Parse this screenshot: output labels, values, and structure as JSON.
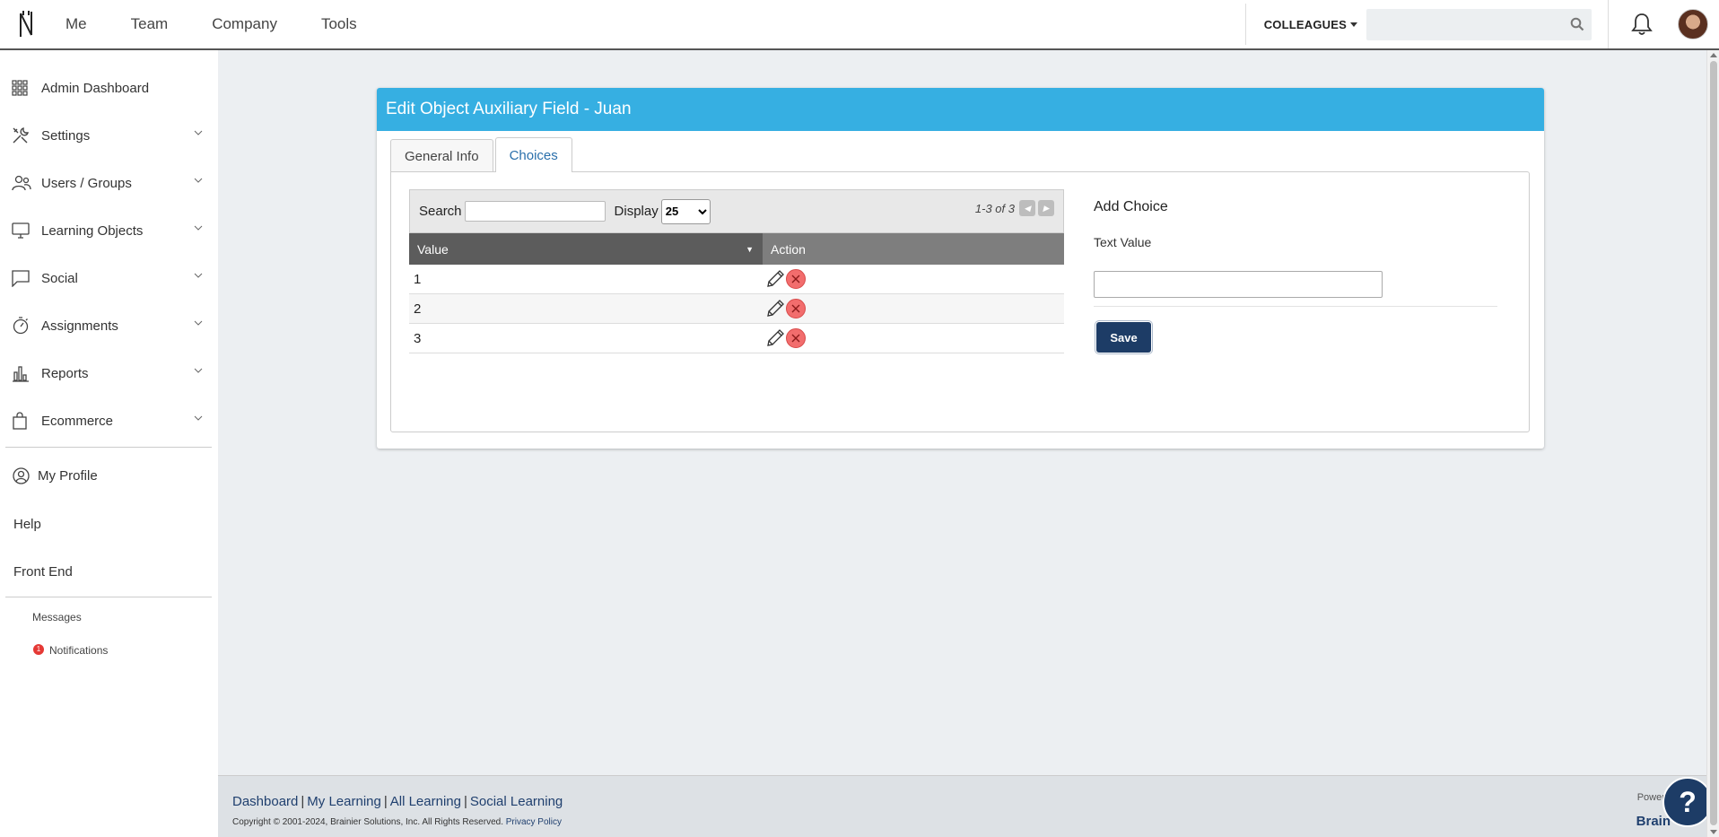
{
  "topnav": {
    "items": [
      "Me",
      "Team",
      "Company",
      "Tools"
    ],
    "colleagues_label": "COLLEAGUES",
    "search_placeholder": ""
  },
  "sidebar": {
    "items": [
      {
        "label": "Admin Dashboard",
        "icon": "grid-icon"
      },
      {
        "label": "Settings",
        "icon": "tools-icon"
      },
      {
        "label": "Users / Groups",
        "icon": "users-icon"
      },
      {
        "label": "Learning Objects",
        "icon": "monitor-icon"
      },
      {
        "label": "Social",
        "icon": "chat-icon"
      },
      {
        "label": "Assignments",
        "icon": "timer-icon"
      },
      {
        "label": "Reports",
        "icon": "bar-chart-icon"
      },
      {
        "label": "Ecommerce",
        "icon": "shopping-bag-icon"
      }
    ],
    "my_profile": "My Profile",
    "help": "Help",
    "front_end": "Front End",
    "messages": "Messages",
    "notifications": "Notifications",
    "notification_count": "1"
  },
  "panel": {
    "title": "Edit Object Auxiliary Field - Juan",
    "tabs": [
      "General Info",
      "Choices"
    ],
    "active_tab": "Choices"
  },
  "grid": {
    "search_label": "Search",
    "display_label": "Display",
    "display_value": "25",
    "pager_text": "1-3 of 3",
    "columns": [
      "Value",
      "Action"
    ],
    "rows": [
      "1",
      "2",
      "3"
    ]
  },
  "add_choice": {
    "title": "Add Choice",
    "text_value_label": "Text Value",
    "text_value": "",
    "save_label": "Save"
  },
  "footer": {
    "links": [
      "Dashboard",
      "My Learning",
      "All Learning",
      "Social Learning"
    ],
    "copyright": "Copyright © 2001-2024, Brainier Solutions, Inc. All Rights Reserved.",
    "privacy": "Privacy Policy",
    "powered": "Powere",
    "brand": "Brain"
  },
  "colors": {
    "header_blue": "#36afe2",
    "navy": "#1d3c66",
    "delete_red": "#f26d6d",
    "notification_red": "#e53935"
  }
}
